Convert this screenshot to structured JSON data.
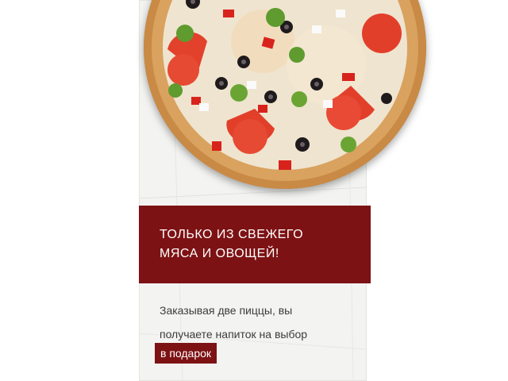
{
  "promo": {
    "headline": "ТОЛЬКО ИЗ СВЕЖЕГО\nМЯСА И ОВОЩЕЙ!",
    "description": "Заказывая две пиццы, вы\nполучаете напиток на выбор",
    "gift_label": "в подарок"
  },
  "colors": {
    "accent": "#7d1214",
    "paper": "#f3f3f1",
    "text": "#3c3c3c"
  },
  "images": {
    "pizza": "pizza-image"
  }
}
